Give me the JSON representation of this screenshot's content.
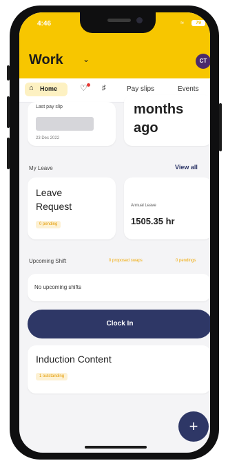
{
  "status": {
    "time": "4:46",
    "battery": "79"
  },
  "header": {
    "title": "Work",
    "avatar_initials": "CT"
  },
  "nav": {
    "items": [
      {
        "label": "Home",
        "icon": "home-icon",
        "active": true
      },
      {
        "icon": "bell-icon",
        "has_notification": true
      },
      {
        "icon": "megaphone-icon"
      },
      {
        "label": "Pay slips"
      },
      {
        "label": "Events"
      }
    ]
  },
  "last_pay_slip": {
    "title": "Last pay slip",
    "date": "23 Dec 2022"
  },
  "time_ago": {
    "line1": "months",
    "line2": "ago"
  },
  "my_leave": {
    "section_label": "My Leave",
    "view_all": "View all",
    "leave_request": {
      "line1": "Leave",
      "line2": "Request",
      "badge": "0 pending"
    },
    "annual_leave": {
      "label": "Annual Leave",
      "value": "1505.35 hr"
    }
  },
  "upcoming_shift": {
    "section_label": "Upcoming Shift",
    "proposed_swaps": "0 proposed swaps",
    "pendings": "0 pendings",
    "empty_text": "No upcoming shifts"
  },
  "clock_in": {
    "label": "Clock In"
  },
  "induction": {
    "title": "Induction Content",
    "badge": "1 outstanding"
  },
  "fab": {
    "icon": "plus-icon",
    "symbol": "+"
  },
  "colors": {
    "header": "#f7c600",
    "accent": "#2e3766",
    "badge_text": "#e39a00",
    "avatar": "#4a2a6b"
  }
}
